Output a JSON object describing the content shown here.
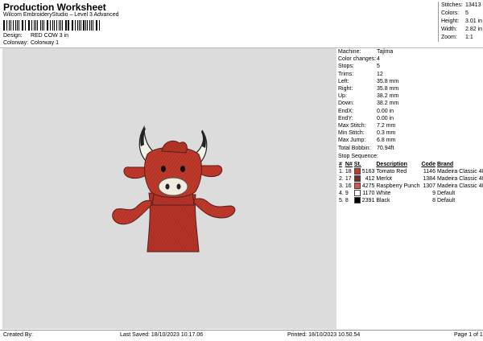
{
  "header": {
    "title": "Production Worksheet",
    "subtitle": "Wilcom EmbroideryStudio – Level 3 Advanced",
    "design_label": "Design:",
    "design_value": "RED COW 3 in",
    "colorway_label": "Colorway:",
    "colorway_value": "Colorway 1"
  },
  "stats": [
    {
      "label": "Stitches:",
      "value": "13413"
    },
    {
      "label": "Colors:",
      "value": "5"
    },
    {
      "label": "Height:",
      "value": "3.01 in"
    },
    {
      "label": "Width:",
      "value": "2.82 in"
    },
    {
      "label": "Zoom:",
      "value": "1:1"
    }
  ],
  "machine_info": [
    {
      "label": "Machine:",
      "value": "Tajima"
    },
    {
      "label": "Color changes:",
      "value": "4"
    },
    {
      "label": "Stops:",
      "value": "5"
    },
    {
      "label": "Trims:",
      "value": "12"
    },
    {
      "label": "Left:",
      "value": "35.8 mm"
    },
    {
      "label": "Right:",
      "value": "35.8 mm"
    },
    {
      "label": "Up:",
      "value": "38.2 mm"
    },
    {
      "label": "Down:",
      "value": "38.2 mm"
    },
    {
      "label": "EndX:",
      "value": "0.00 in"
    },
    {
      "label": "EndY:",
      "value": "0.00 in"
    },
    {
      "label": "Max Stitch:",
      "value": "7.2 mm"
    },
    {
      "label": "Min Stitch:",
      "value": "0.3 mm"
    },
    {
      "label": "Max Jump:",
      "value": "6.8 mm"
    },
    {
      "label": "Total Bobbin:",
      "value": "70.94ft"
    }
  ],
  "stop_sequence": {
    "title": "Stop Sequence:",
    "headers": [
      "#",
      "N#",
      "St.",
      "Description",
      "Code",
      "Brand"
    ],
    "rows": [
      {
        "num": "1.",
        "n": "18",
        "color": "#c0392b",
        "st": "5163",
        "desc": "Tomato Red",
        "code": "1146",
        "brand": "Madeira Classic 40"
      },
      {
        "num": "2.",
        "n": "17",
        "color": "#7a2a2a",
        "st": "412",
        "desc": "Merlot",
        "code": "1384",
        "brand": "Madeira Classic 40"
      },
      {
        "num": "3.",
        "n": "16",
        "color": "#d9534f",
        "st": "4275",
        "desc": "Raspberry Punch",
        "code": "1307",
        "brand": "Madeira Classic 40"
      },
      {
        "num": "4.",
        "n": "9",
        "color": "#ffffff",
        "st": "1170",
        "desc": "White",
        "code": "9",
        "brand": "Default"
      },
      {
        "num": "5.",
        "n": "8",
        "color": "#000000",
        "st": "2391",
        "desc": "Black",
        "code": "8",
        "brand": "Default"
      }
    ]
  },
  "footer": {
    "created_by": "Created By:",
    "last_saved": "Last Saved: 18/10/2023 10.17.06",
    "printed": "Printed: 18/10/2023 10.50.54",
    "page": "Page 1 of 1"
  },
  "colors": {
    "canvas_bg": "#dcdcdc",
    "cow_red": "#c0392b",
    "cow_dark": "#7a2a2a",
    "horn": "#f2f2e6"
  }
}
